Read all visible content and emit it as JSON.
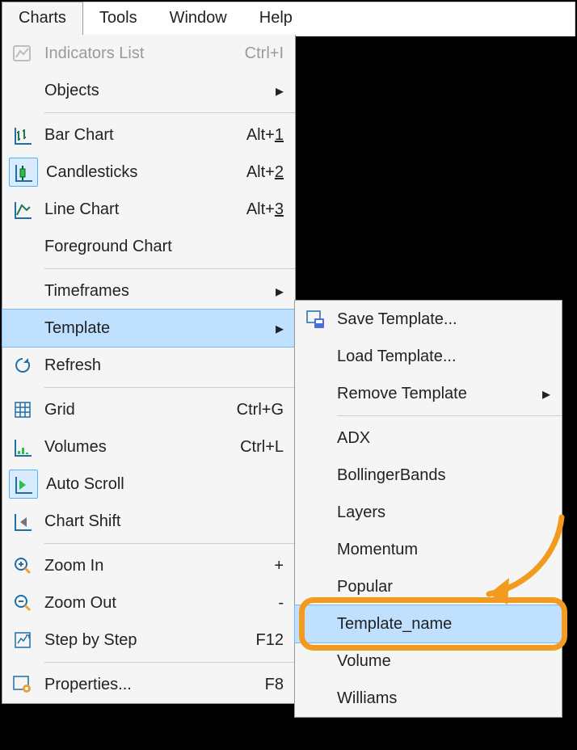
{
  "menubar": {
    "items": [
      {
        "label": "Charts",
        "active": true
      },
      {
        "label": "Tools",
        "active": false
      },
      {
        "label": "Window",
        "active": false
      },
      {
        "label": "Help",
        "active": false
      }
    ]
  },
  "menu": {
    "indicators": {
      "label": "Indicators List",
      "shortcut": "Ctrl+I"
    },
    "objects": {
      "label": "Objects"
    },
    "bar": {
      "label": "Bar Chart",
      "shortcut_prefix": "Alt+",
      "shortcut_key": "1"
    },
    "candles": {
      "label": "Candlesticks",
      "shortcut_prefix": "Alt+",
      "shortcut_key": "2"
    },
    "line": {
      "label": "Line Chart",
      "shortcut_prefix": "Alt+",
      "shortcut_key": "3"
    },
    "fg": {
      "label": "Foreground Chart"
    },
    "timeframes": {
      "label": "Timeframes"
    },
    "template": {
      "label": "Template"
    },
    "refresh": {
      "label": "Refresh"
    },
    "grid": {
      "label": "Grid",
      "shortcut": "Ctrl+G"
    },
    "volumes": {
      "label": "Volumes",
      "shortcut": "Ctrl+L"
    },
    "autoscroll": {
      "label": "Auto Scroll"
    },
    "chartshift": {
      "label": "Chart Shift"
    },
    "zoomin": {
      "label": "Zoom In",
      "shortcut": "+"
    },
    "zoomout": {
      "label": "Zoom Out",
      "shortcut": "-"
    },
    "step": {
      "label": "Step by Step",
      "shortcut": "F12"
    },
    "props": {
      "label": "Properties...",
      "shortcut": "F8"
    }
  },
  "submenu": {
    "save": {
      "label": "Save Template..."
    },
    "load": {
      "label": "Load Template..."
    },
    "remove": {
      "label": "Remove Template"
    },
    "tpl": [
      "ADX",
      "BollingerBands",
      "Layers",
      "Momentum",
      "Popular",
      "Template_name",
      "Volume",
      "Williams"
    ],
    "highlight_index": 5
  }
}
